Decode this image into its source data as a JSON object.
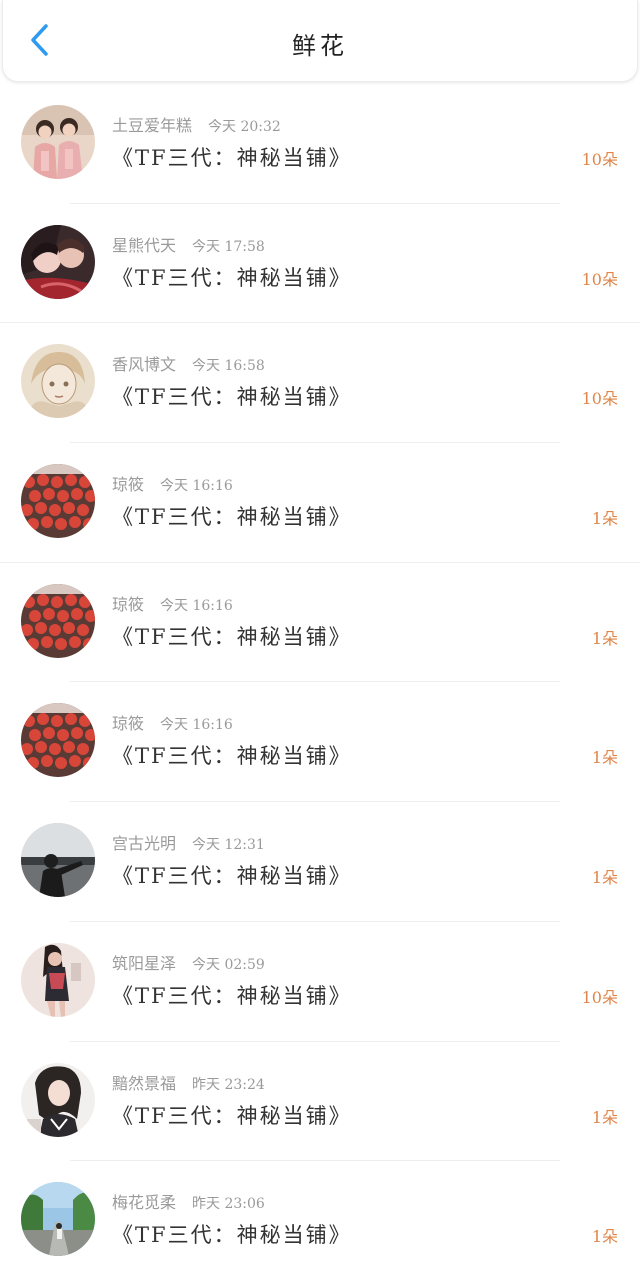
{
  "header": {
    "title": "鲜花",
    "back_icon": "chevron-left-icon",
    "accent": "#2f9bf0"
  },
  "count_color": "#e0864a",
  "items": [
    {
      "name": "土豆爱年糕",
      "time": "今天 20:32",
      "book": "《TF三代：神秘当铺》",
      "count": "10朵"
    },
    {
      "name": "星熊代天",
      "time": "今天 17:58",
      "book": "《TF三代：神秘当铺》",
      "count": "10朵"
    },
    {
      "name": "香风博文",
      "time": "今天 16:58",
      "book": "《TF三代：神秘当铺》",
      "count": "10朵"
    },
    {
      "name": "琼筱",
      "time": "今天 16:16",
      "book": "《TF三代：神秘当铺》",
      "count": "1朵"
    },
    {
      "name": "琼筱",
      "time": "今天 16:16",
      "book": "《TF三代：神秘当铺》",
      "count": "1朵"
    },
    {
      "name": "琼筱",
      "time": "今天 16:16",
      "book": "《TF三代：神秘当铺》",
      "count": "1朵"
    },
    {
      "name": "宫古光明",
      "time": "今天 12:31",
      "book": "《TF三代：神秘当铺》",
      "count": "1朵"
    },
    {
      "name": "筑阳星泽",
      "time": "今天 02:59",
      "book": "《TF三代：神秘当铺》",
      "count": "10朵"
    },
    {
      "name": "黯然景福",
      "time": "昨天 23:24",
      "book": "《TF三代：神秘当铺》",
      "count": "1朵"
    },
    {
      "name": "梅花觅柔",
      "time": "昨天 23:06",
      "book": "《TF三代：神秘当铺》",
      "count": "1朵"
    }
  ]
}
